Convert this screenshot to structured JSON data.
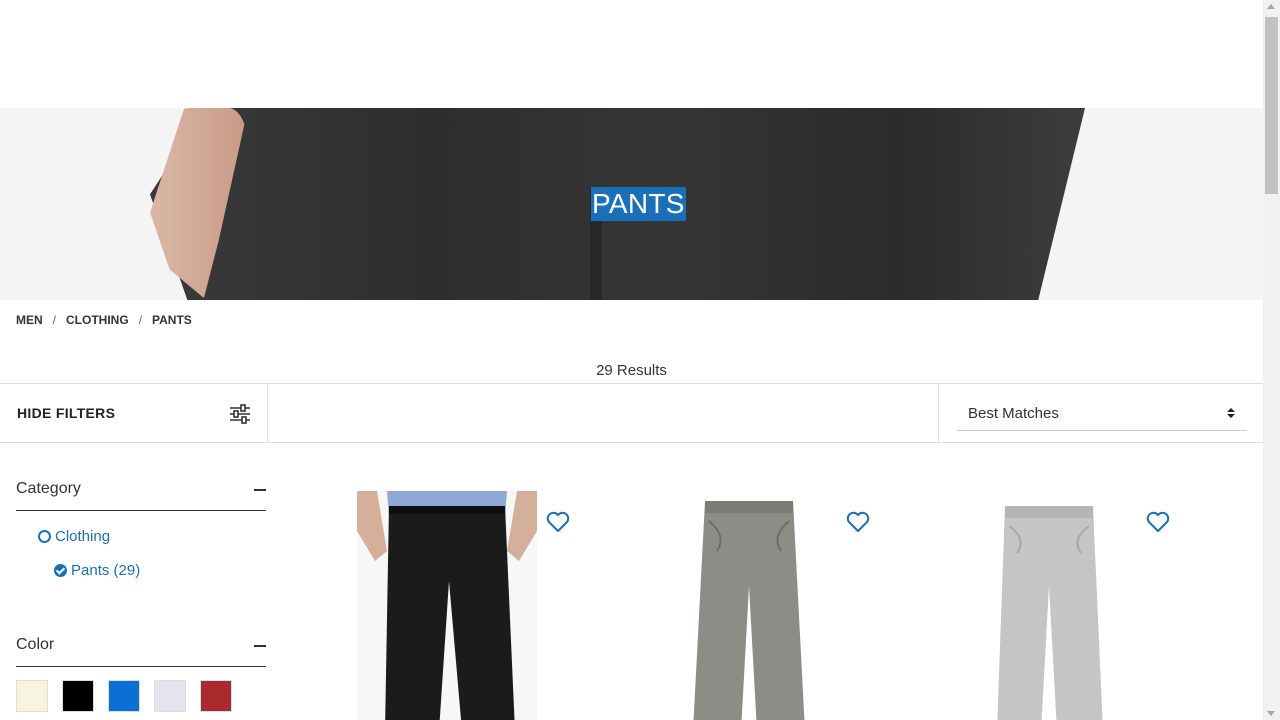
{
  "hero": {
    "title": "PANTS"
  },
  "breadcrumb": [
    {
      "label": "MEN"
    },
    {
      "label": "CLOTHING"
    },
    {
      "label": "PANTS"
    }
  ],
  "breadcrumb_separator": "/",
  "results": {
    "count_text": "29 Results"
  },
  "toolbar": {
    "hide_filters_label": "HIDE FILTERS",
    "sort_selected": "Best Matches"
  },
  "filters": {
    "category": {
      "title": "Category",
      "items": [
        {
          "label": "Clothing",
          "checked": false
        },
        {
          "label": "Pants (29)",
          "checked": true
        }
      ]
    },
    "color": {
      "title": "Color",
      "swatches": [
        "#f7f5dd",
        "#000000",
        "#0a6fd6",
        "#e4e4ee",
        "#a82a2a"
      ]
    }
  },
  "products": [
    {
      "image": "black-dress-pants",
      "wishlist_icon": "heart-outline-icon"
    },
    {
      "image": "grey-five-pocket-pants",
      "wishlist_icon": "heart-outline-icon"
    },
    {
      "image": "light-grey-chinos",
      "wishlist_icon": "heart-outline-icon"
    }
  ],
  "colors": {
    "accent": "#1a70b8",
    "text": "#333333",
    "border": "#dddddd"
  }
}
